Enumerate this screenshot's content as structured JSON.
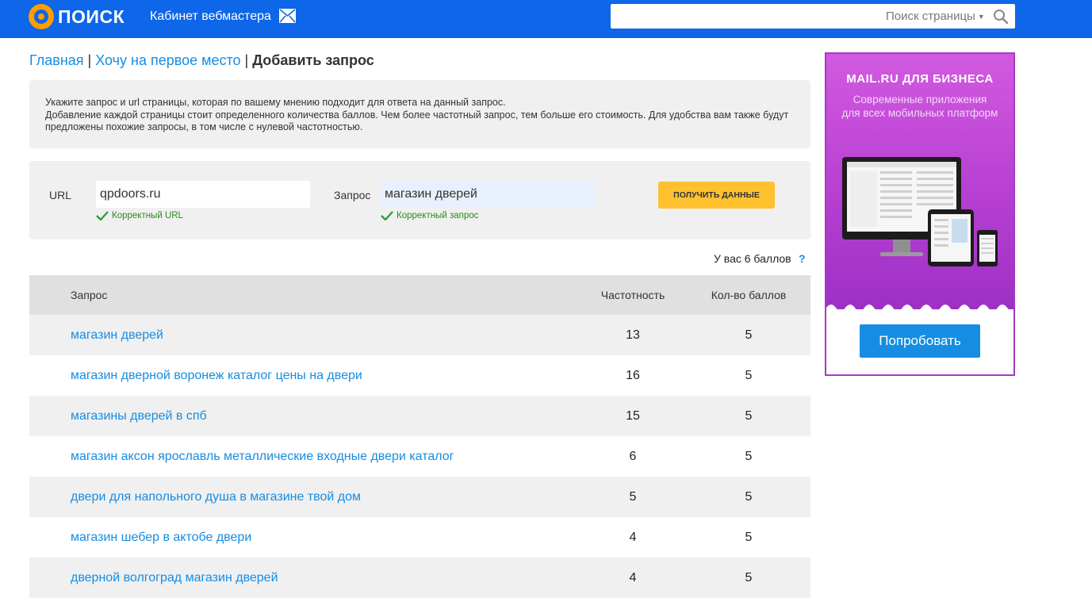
{
  "header": {
    "logo_text": "ПОИСК",
    "cabinet_label": "Кабинет вебмастера",
    "search_value": "",
    "search_scope": "Поиск страницы",
    "colors": {
      "bar": "#0e66e8",
      "logo_accent": "#ff9e00"
    }
  },
  "breadcrumb": {
    "home": "Главная",
    "sep1": "|",
    "section": "Хочу на первое место",
    "sep2": "|",
    "current": "Добавить запрос"
  },
  "info": {
    "line1": "Укажите запрос и url страницы, которая по вашему мнению подходит для ответа на данный запрос.",
    "line2": "Добавление каждой страницы стоит определенного количества баллов. Чем более частотный запрос, тем больше его стоимость. Для удобства вам также будут предложены похожие запросы, в том числе с нулевой частотностью."
  },
  "form": {
    "url_label": "URL",
    "url_value": "qpdoors.ru",
    "url_status": "Корректный URL",
    "query_label": "Запрос",
    "query_value": "магазин дверей",
    "query_status": "Корректный запрос",
    "submit_label": "ПОЛУЧИТЬ ДАННЫЕ"
  },
  "points": {
    "text": "У вас 6 баллов",
    "help": "?"
  },
  "table": {
    "headers": {
      "query": "Запрос",
      "frequency": "Частотность",
      "points": "Кол-во баллов"
    },
    "rows": [
      {
        "query": "магазин дверей",
        "frequency": "13",
        "points": "5"
      },
      {
        "query": "магазин дверной воронеж каталог цены на двери",
        "frequency": "16",
        "points": "5"
      },
      {
        "query": "магазины дверей в спб",
        "frequency": "15",
        "points": "5"
      },
      {
        "query": "магазин аксон ярославль металлические входные двери каталог",
        "frequency": "6",
        "points": "5"
      },
      {
        "query": "двери для напольного душа в магазине твой дом",
        "frequency": "5",
        "points": "5"
      },
      {
        "query": "магазин шебер в актобе двери",
        "frequency": "4",
        "points": "5"
      },
      {
        "query": "дверной волгоград магазин дверей",
        "frequency": "4",
        "points": "5"
      }
    ]
  },
  "ad": {
    "title": "MAIL.RU ДЛЯ БИЗНЕСА",
    "subtitle_line1": "Современные приложения",
    "subtitle_line2": "для всех мобильных платформ",
    "button": "Попробовать"
  }
}
